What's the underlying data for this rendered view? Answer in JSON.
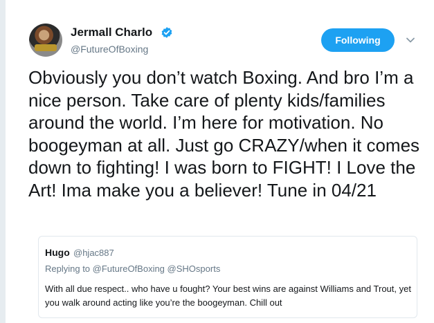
{
  "tweet": {
    "author": {
      "display_name": "Jermall Charlo",
      "handle": "@FutureOfBoxing",
      "verified": true
    },
    "follow_button_label": "Following",
    "text": "Obviously you don’t watch Boxing. And bro I’m a nice person. Take care of plenty kids/families around the world. I’m here for motivation. No boogeyman at all. Just go CRAZY/when it comes down to fighting! I was born to FIGHT! I Love the Art! Ima make you a believer! Tune in 04/21"
  },
  "quoted_tweet": {
    "display_name": "Hugo",
    "handle": "@hjac887",
    "replying_prefix": "Replying to",
    "replying_to": [
      "@FutureOfBoxing",
      "@SHOsports"
    ],
    "text": "With all due respect.. who have u fought? Your best wins are against Williams and Trout, yet you walk around acting like you’re the boogeyman. Chill out"
  },
  "colors": {
    "accent": "#1da1f2",
    "secondary_text": "#657786",
    "border": "#e1e8ed",
    "background": "#e6ecf0"
  },
  "icons": {
    "verified": "verified-badge-icon",
    "menu": "chevron-down-icon"
  }
}
